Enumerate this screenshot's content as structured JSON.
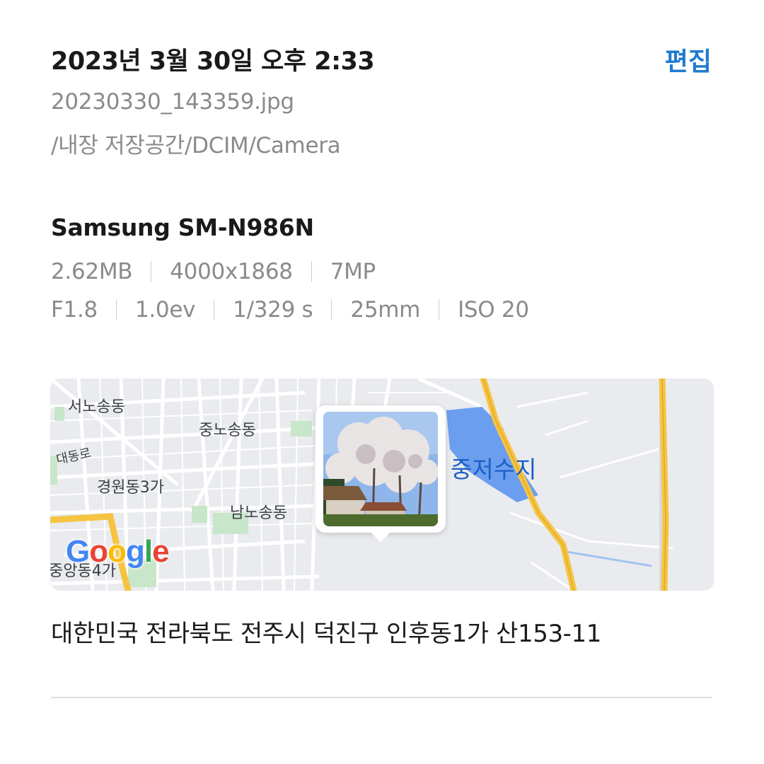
{
  "header": {
    "datetime": "2023년 3월 30일 오후 2:33",
    "edit_label": "편집",
    "accent_color": "#1f7ad0"
  },
  "file": {
    "name": "20230330_143359.jpg",
    "path": "/내장 저장공간/DCIM/Camera"
  },
  "camera": {
    "device": "Samsung SM-N986N",
    "size": "2.62MB",
    "resolution": "4000x1868",
    "megapixels": "7MP",
    "aperture": "F1.8",
    "exposure_value": "1.0ev",
    "shutter": "1/329 s",
    "focal_length": "25mm",
    "iso": "ISO 20"
  },
  "map": {
    "labels": {
      "seono": "서노송동",
      "jungno": "중노송동",
      "daedong": "대동로",
      "gyeongwon": "경원동3가",
      "namno": "남노송동",
      "reservoir": "중저수지",
      "jungang": "중앙동4가"
    },
    "logo": [
      "G",
      "o",
      "o",
      "g",
      "l",
      "e"
    ],
    "photo_marker_icon": "photo-thumbnail-pin"
  },
  "location": {
    "address": "대한민국 전라북도 전주시 덕진구 인후동1가 산153-11"
  }
}
